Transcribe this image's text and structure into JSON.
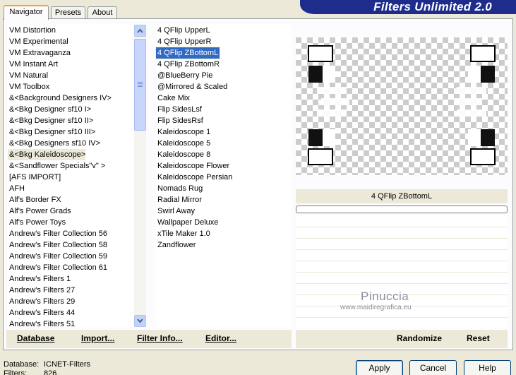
{
  "title": "Filters Unlimited 2.0",
  "tabs": [
    "Navigator",
    "Presets",
    "About"
  ],
  "categories": [
    "VM Distortion",
    "VM Experimental",
    "VM Extravaganza",
    "VM Instant Art",
    "VM Natural",
    "VM Toolbox",
    "&<Background Designers IV>",
    "&<Bkg Designer sf10 I>",
    "&<Bkg Designer sf10 II>",
    "&<Bkg Designer sf10 III>",
    "&<Bkg Designers sf10 IV>",
    "&<Bkg Kaleidoscope>",
    "&<Sandflower Specials\"v\" >",
    "[AFS IMPORT]",
    "AFH",
    "Alf's Border FX",
    "Alf's Power Grads",
    "Alf's Power Toys",
    "Andrew's Filter Collection 56",
    "Andrew's Filter Collection 58",
    "Andrew's Filter Collection 59",
    "Andrew's Filter Collection 61",
    "Andrew's Filters 1",
    "Andrew's Filters 27",
    "Andrew's Filters 29",
    "Andrew's Filters 44",
    "Andrew's Filters 51"
  ],
  "selected_category": "&<Bkg Kaleidoscope>",
  "filters": [
    "4 QFlip UpperL",
    "4 QFlip UpperR",
    "4 QFlip ZBottomL",
    "4 QFlip ZBottomR",
    "@BlueBerry Pie",
    "@Mirrored & Scaled",
    "Cake Mix",
    "Flip SidesLsf",
    "Flip SidesRsf",
    "Kaleidoscope 1",
    "Kaleidoscope 5",
    "Kaleidoscope 8",
    "Kaleidoscope Flower",
    "Kaleidoscope Persian",
    "Nomads Rug",
    "Radial Mirror",
    "Swirl Away",
    "Wallpaper Deluxe",
    "xTile Maker 1.0",
    "Zandflower"
  ],
  "selected_filter": "4 QFlip ZBottomL",
  "preview_name": "4 QFlip ZBottomL",
  "watermark": {
    "name": "Pinuccia",
    "site": "www.maidiregrafica.eu"
  },
  "toolbar": {
    "database": "Database",
    "import": "Import...",
    "filter_info": "Filter Info...",
    "editor": "Editor...",
    "randomize": "Randomize",
    "reset": "Reset"
  },
  "status": {
    "database_label": "Database:",
    "database_value": "ICNET-Filters",
    "filters_label": "Filters:",
    "filters_value": "826"
  },
  "buttons": {
    "apply": "Apply",
    "cancel": "Cancel",
    "help": "Help"
  },
  "colors": {
    "title_bar": "#1e2c8c",
    "selection": "#316ac5",
    "tab_accent": "#f0a22e"
  }
}
